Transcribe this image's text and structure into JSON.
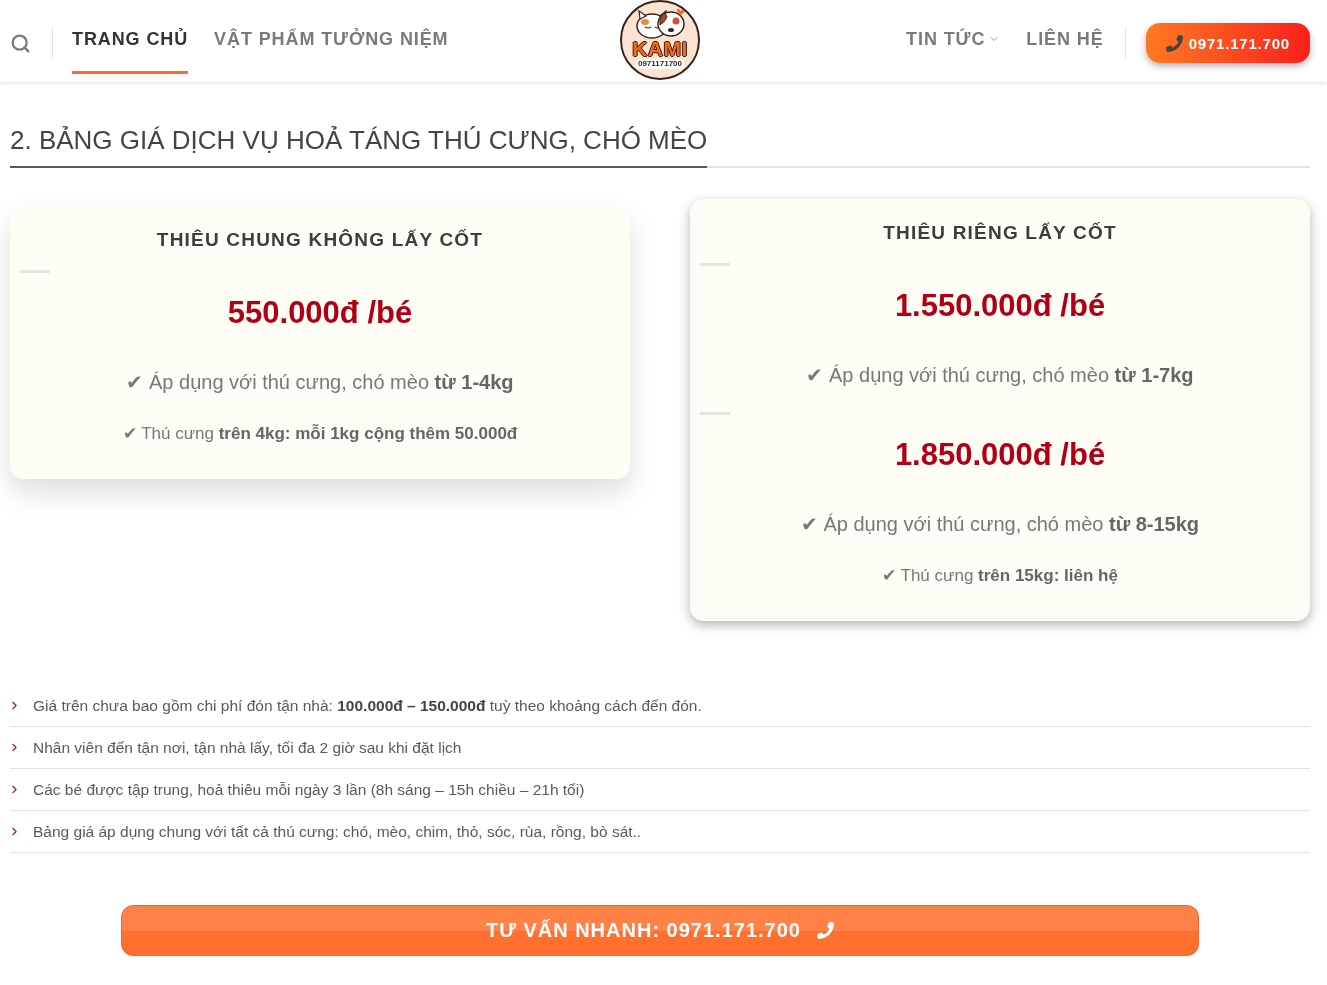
{
  "header": {
    "nav_left": [
      {
        "label": "TRANG CHỦ",
        "selected": true,
        "dropdown": false
      },
      {
        "label": "VẬT PHẨM TƯỞNG NIỆM",
        "selected": false,
        "dropdown": false
      }
    ],
    "logo": {
      "wordmark": "KAMI",
      "phone": "0971171700"
    },
    "nav_right": [
      {
        "label": "TIN TỨC",
        "selected": false,
        "dropdown": true
      },
      {
        "label": "LIÊN HỆ",
        "selected": false,
        "dropdown": false
      }
    ],
    "call_button": {
      "label": "0971.171.700"
    }
  },
  "pricing": {
    "heading": "2. BẢNG GIÁ DỊCH VỤ HOẢ TÁNG THÚ CƯNG, CHÓ MÈO",
    "cards": [
      {
        "title": "THIÊU CHUNG KHÔNG LẤY CỐT",
        "raised": false,
        "tiers": [
          {
            "price": "550.000đ /bé",
            "lines": [
              {
                "kind": "main",
                "text": "✔ Áp dụng với thú cưng, chó mèo **từ 1-4kg**"
              },
              {
                "kind": "note",
                "text": "✔ Thú cưng **trên 4kg: mỗi 1kg cộng thêm 50.000đ**"
              }
            ]
          }
        ]
      },
      {
        "title": "THIÊU RIÊNG LẤY CỐT",
        "raised": true,
        "tiers": [
          {
            "price": "1.550.000đ /bé",
            "lines": [
              {
                "kind": "main",
                "text": "✔ Áp dụng với thú cưng, chó mèo **từ 1-7kg**"
              }
            ]
          },
          {
            "price": "1.850.000đ /bé",
            "lines": [
              {
                "kind": "main",
                "text": "✔ Áp dụng với thú cưng, chó mèo **từ 8-15kg**"
              },
              {
                "kind": "note",
                "text": "✔ Thú cưng **trên 15kg: liên hệ**"
              }
            ]
          }
        ]
      }
    ],
    "notes": [
      "Giá trên chưa bao gồm chi phí đón tận nhà: **100.000đ – 150.000đ** tuỳ theo khoảng cách đến đón.",
      "Nhân viên đến tận nơi, tận nhà lấy, tối đa 2 giờ sau khi đặt lịch",
      "Các bé được tập trung, hoả thiêu mỗi ngày 3 lần (8h sáng – 15h chiều – 21h tối)",
      "Bảng giá áp dụng chung với tất cả thú cưng: chó, mèo, chim, thỏ, sóc, rùa, rồng, bò sát.."
    ],
    "cta": {
      "label": "TƯ VẤN NHANH: 0971.171.700"
    }
  }
}
